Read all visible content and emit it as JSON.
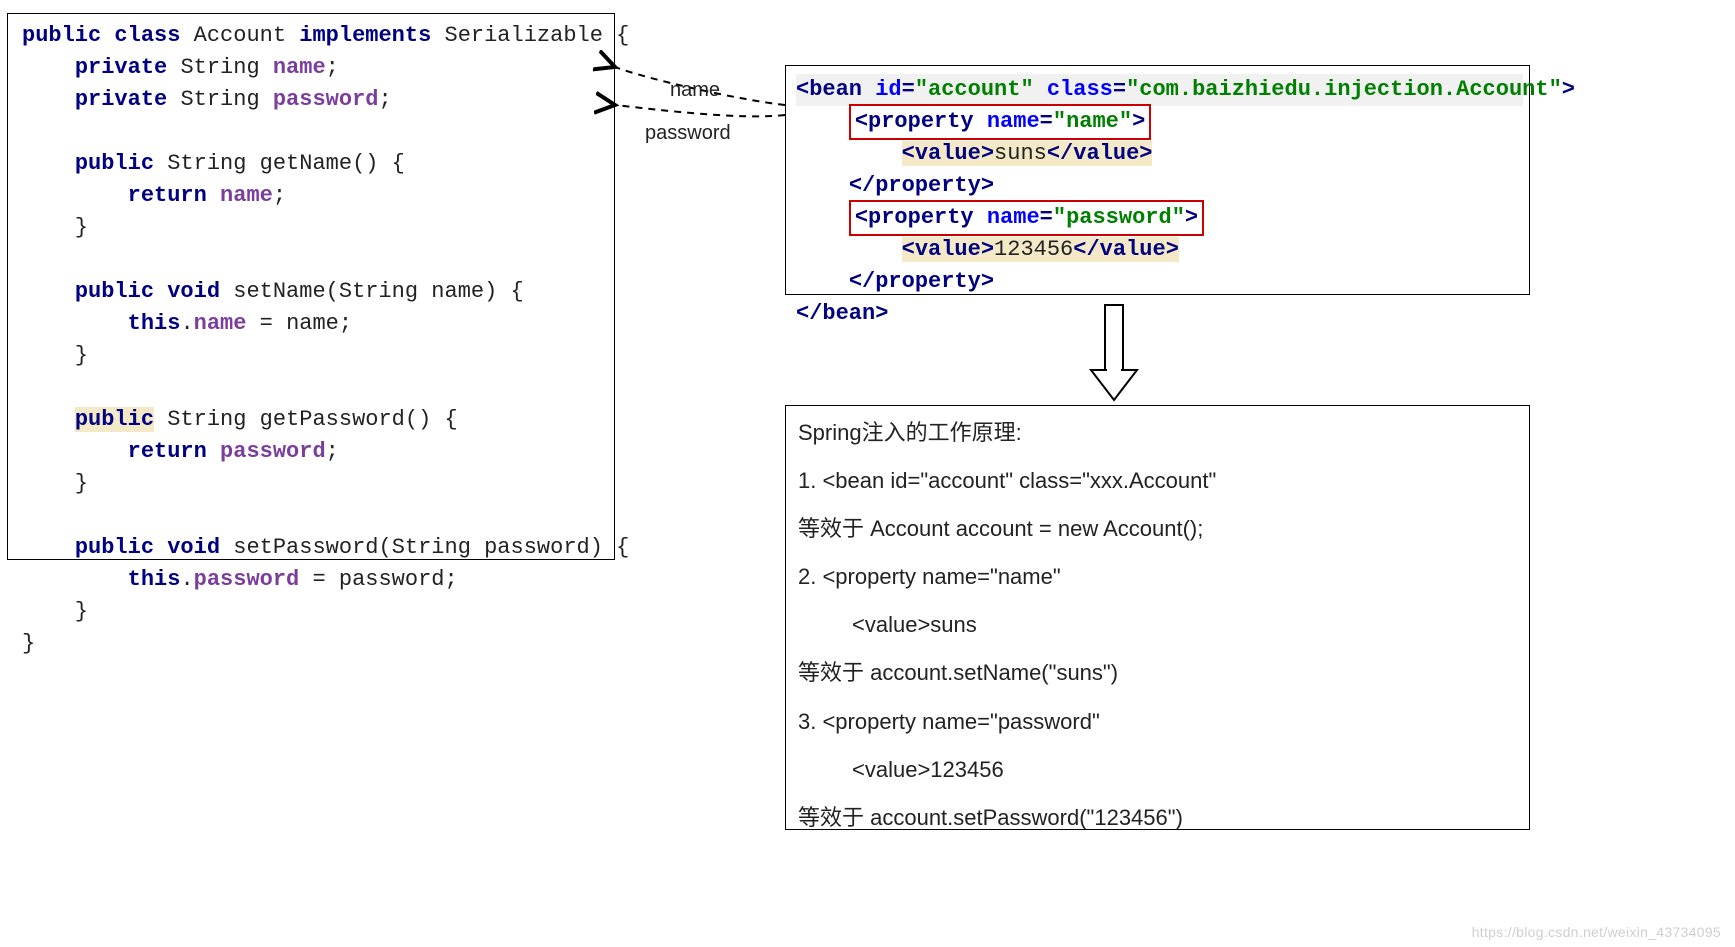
{
  "java": {
    "kw_public": "public",
    "kw_class": "class",
    "cls": "Account",
    "kw_implements": "implements",
    "iface": "Serializable",
    "kw_private": "private",
    "type_string": "String",
    "f_name": "name",
    "f_password": "password",
    "kw_void": "void",
    "kw_return": "return",
    "kw_this": "this",
    "m_getName": "getName",
    "m_setName": "setName",
    "m_getPassword": "getPassword",
    "m_setPassword": "setPassword",
    "p_name": "name",
    "p_password": "password"
  },
  "xml": {
    "bean_tag": "bean",
    "id_attr": "id",
    "id_val": "account",
    "class_attr": "class",
    "class_val": "com.baizhiedu.injection.Account",
    "prop_tag": "property",
    "name_attr": "name",
    "name_val1": "name",
    "name_val2": "password",
    "value_tag": "value",
    "value1": "suns",
    "value2": "123456"
  },
  "labels": {
    "l1": "name",
    "l2": "password"
  },
  "explain": {
    "title": "Spring注入的工作原理:",
    "l1": "1. <bean id=\"account\"  class=\"xxx.Account\"",
    "l1eq": "等效于  Account  account = new Account();",
    "l2": "2. <property name=\"name\"",
    "l2b": "<value>suns",
    "l2eq": "等效于  account.setName(\"suns\")",
    "l3": "3. <property name=\"password\"",
    "l3b": "<value>123456",
    "l3eq": "等效于  account.setPassword(\"123456\")"
  },
  "watermark": "https://blog.csdn.net/weixin_43734095"
}
